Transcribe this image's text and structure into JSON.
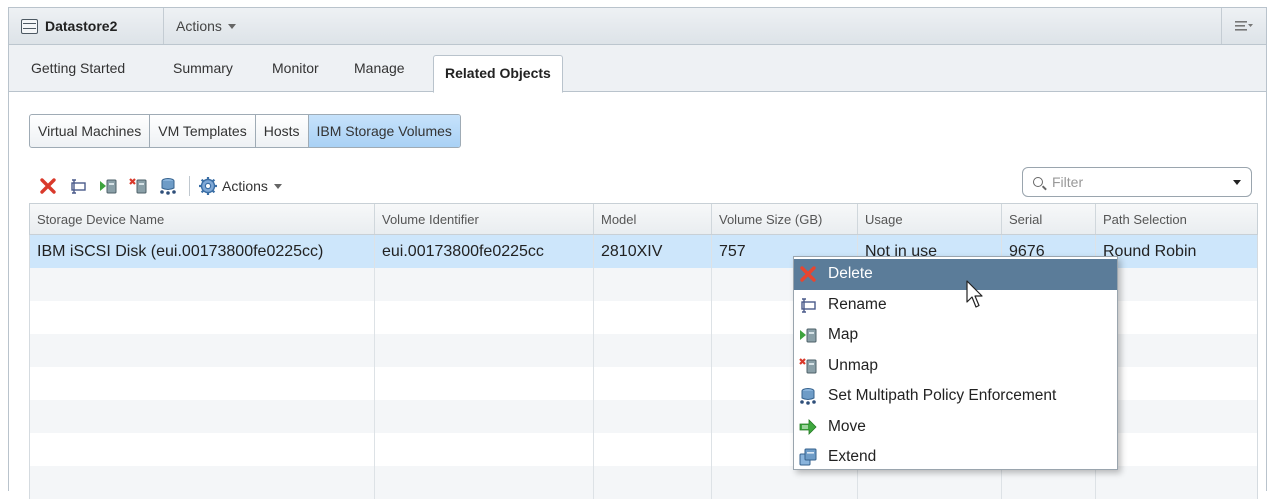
{
  "window": {
    "title": "Datastore2",
    "actions_label": "Actions",
    "menu_icon": "list-menu-icon"
  },
  "tabs": [
    {
      "label": "Getting Started",
      "active": false
    },
    {
      "label": "Summary",
      "active": false
    },
    {
      "label": "Monitor",
      "active": false
    },
    {
      "label": "Manage",
      "active": false
    },
    {
      "label": "Related Objects",
      "active": true
    }
  ],
  "subtabs": [
    {
      "label": "Virtual Machines",
      "selected": false
    },
    {
      "label": "VM Templates",
      "selected": false
    },
    {
      "label": "Hosts",
      "selected": false
    },
    {
      "label": "IBM Storage Volumes",
      "selected": true
    }
  ],
  "toolbar": {
    "icons": [
      "delete-icon",
      "rename-icon",
      "map-icon",
      "unmap-icon",
      "multipath-icon"
    ],
    "actions_label": "Actions"
  },
  "filter": {
    "placeholder": "Filter"
  },
  "grid": {
    "columns": [
      "Storage Device Name",
      "Volume Identifier",
      "Model",
      "Volume Size (GB)",
      "Usage",
      "Serial",
      "Path Selection"
    ],
    "rows": [
      [
        "IBM iSCSI Disk (eui.00173800fe0225cc)",
        "eui.00173800fe0225cc",
        "2810XIV",
        "757",
        "Not in use",
        "9676",
        "Round Robin"
      ]
    ]
  },
  "context_menu": {
    "items": [
      {
        "label": "Delete",
        "icon": "delete-icon",
        "highlighted": true
      },
      {
        "label": "Rename",
        "icon": "rename-icon",
        "highlighted": false
      },
      {
        "label": "Map",
        "icon": "map-icon",
        "highlighted": false
      },
      {
        "label": "Unmap",
        "icon": "unmap-icon",
        "highlighted": false
      },
      {
        "label": "Set Multipath Policy Enforcement",
        "icon": "multipath-icon",
        "highlighted": false
      },
      {
        "label": "Move",
        "icon": "move-icon",
        "highlighted": false
      },
      {
        "label": "Extend",
        "icon": "extend-icon",
        "highlighted": false
      }
    ]
  },
  "colors": {
    "selection": "#cde6fb",
    "menu_highlight": "#5b7c99",
    "subtab_selected": "#a9d1f5"
  }
}
